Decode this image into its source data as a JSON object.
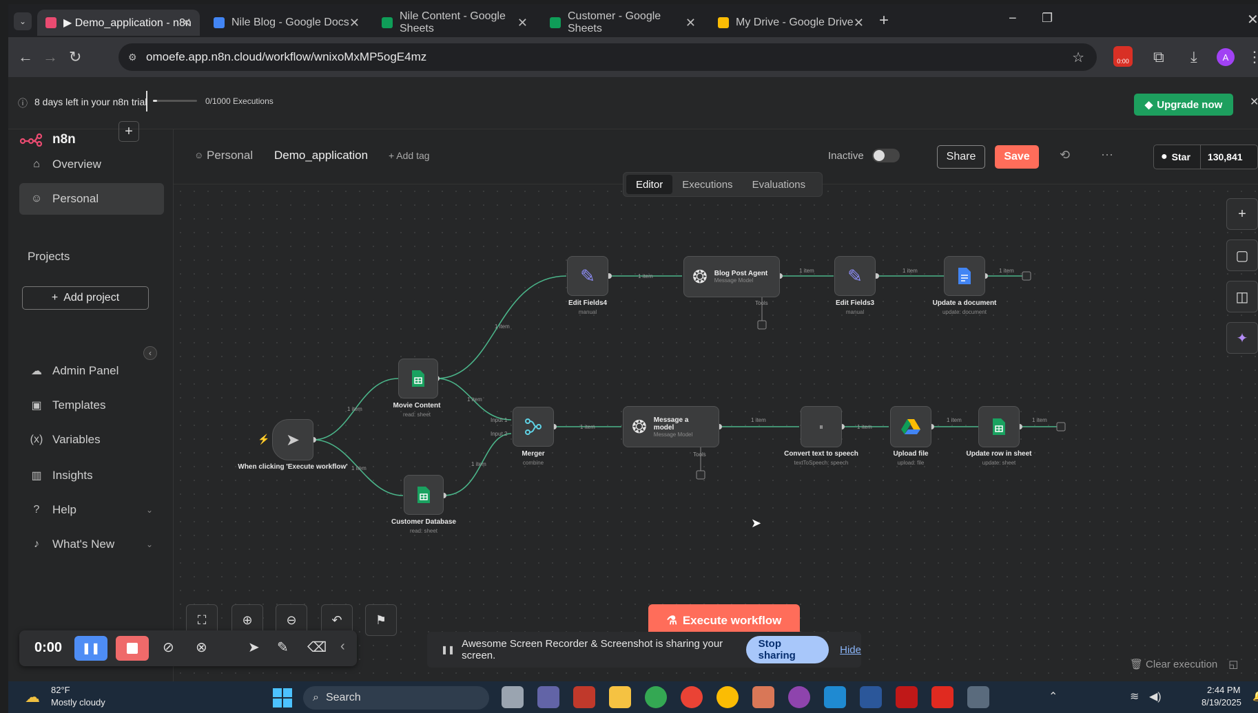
{
  "browser": {
    "tabs": [
      {
        "title": "▶ Demo_application - n8n",
        "icon": "n8n-icon",
        "color": "#ea4b71"
      },
      {
        "title": "Nile Blog - Google Docs",
        "icon": "docs-icon",
        "color": "#4285f4"
      },
      {
        "title": "Nile Content - Google Sheets",
        "icon": "sheets-icon",
        "color": "#0f9d58"
      },
      {
        "title": "Customer - Google Sheets",
        "icon": "sheets-icon",
        "color": "#0f9d58"
      },
      {
        "title": "My Drive - Google Drive",
        "icon": "drive-icon",
        "color": "#fbbc04"
      }
    ],
    "url": "omoefe.app.n8n.cloud/workflow/wnixoMxMP5ogE4mz",
    "rec_badge": "0:00",
    "profile_initial": "A"
  },
  "trial": {
    "days_text": "8 days left in your n8n trial",
    "executions": "0/1000 Executions",
    "upgrade_label": "Upgrade now"
  },
  "sidebar": {
    "logo": "n8n",
    "overview": "Overview",
    "personal": "Personal",
    "projects": "Projects",
    "add_project": "Add project",
    "admin_panel": "Admin Panel",
    "templates": "Templates",
    "variables": "Variables",
    "insights": "Insights",
    "help": "Help",
    "whats_new": "What's New"
  },
  "header": {
    "project": "Personal",
    "workflow_name": "Demo_application",
    "add_tag": "+ Add tag",
    "status": "Inactive",
    "share": "Share",
    "save": "Save",
    "star": "Star",
    "star_count": "130,841",
    "tabs": [
      "Editor",
      "Executions",
      "Evaluations"
    ]
  },
  "nodes": {
    "trigger": {
      "label": "When clicking 'Execute workflow'",
      "sub": ""
    },
    "movie": {
      "label": "Movie Content",
      "sub": "read: sheet"
    },
    "customer": {
      "label": "Customer Database",
      "sub": "read: sheet"
    },
    "merger": {
      "label": "Merger",
      "sub": "combine",
      "input1": "Input 1",
      "input2": "Input 2"
    },
    "edit4": {
      "label": "Edit Fields4",
      "sub": "manual"
    },
    "blog": {
      "label": "Blog Post Agent",
      "sub": "Message Model",
      "tools": "Tools"
    },
    "edit3": {
      "label": "Edit Fields3",
      "sub": "manual"
    },
    "update_doc": {
      "label": "Update a document",
      "sub": "update: document"
    },
    "message": {
      "label": "Message a model",
      "sub": "Message Model",
      "tools": "Tools"
    },
    "tts": {
      "label": "Convert text to speech",
      "sub": "textToSpeech: speech"
    },
    "upload": {
      "label": "Upload file",
      "sub": "upload: file"
    },
    "update_row": {
      "label": "Update row in sheet",
      "sub": "update: sheet"
    }
  },
  "edges": {
    "item": "1 item"
  },
  "canvas": {
    "execute": "Execute workflow",
    "clear": "Clear execution"
  },
  "recorder": {
    "time": "0:00"
  },
  "share": {
    "message": "Awesome Screen Recorder & Screenshot is sharing your screen.",
    "stop": "Stop sharing",
    "hide": "Hide"
  },
  "taskbar": {
    "temp": "82°F",
    "weather": "Mostly cloudy",
    "search": "Search",
    "time": "2:44 PM",
    "date": "8/19/2025"
  },
  "colors": {
    "accent": "#ff6d5a",
    "upgrade": "#1d9f5e",
    "edge": "#4bb58a"
  }
}
